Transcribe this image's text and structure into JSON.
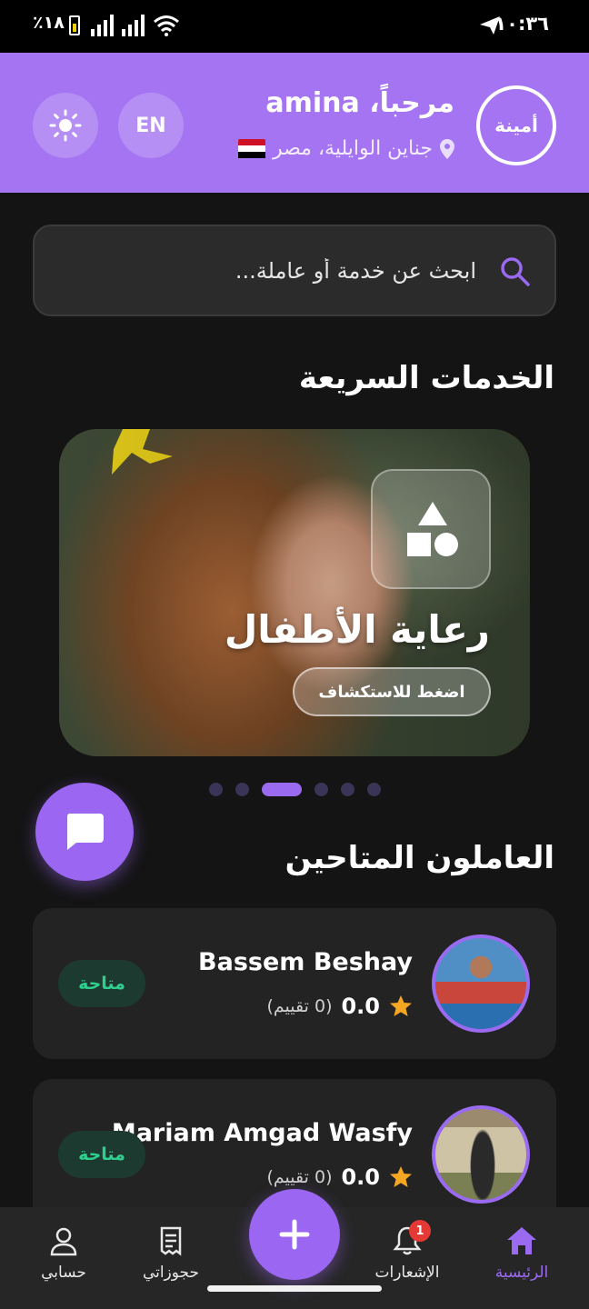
{
  "status_bar": {
    "time": "١٠:٣٦",
    "battery_pct": "٪١٨",
    "icons": [
      "telegram-send-icon",
      "battery-icon",
      "signal-icon",
      "signal-icon",
      "wifi-icon"
    ]
  },
  "header": {
    "logo_text": "أمينة",
    "greeting": "مرحباً، amina",
    "location": "جناين الوايلية، مصر",
    "flag": "egypt-flag-icon",
    "lang_button": "EN",
    "theme_icon": "sun-icon",
    "background_color": "#a474f2"
  },
  "search": {
    "placeholder": "ابحث عن خدمة أو عاملة...",
    "value": "",
    "icon": "search-icon"
  },
  "quick_services": {
    "title": "الخدمات السريعة",
    "carousel": {
      "title": "رعاية الأطفال",
      "cta": "اضغط للاستكشاف",
      "icon": "shapes-icon",
      "slide_count": 6,
      "active_index": 2
    }
  },
  "workers": {
    "title": "العاملون المتاحين",
    "items": [
      {
        "name": "Bassem Beshay",
        "rating": "0.0",
        "rating_count": "(0 تقييم)",
        "status": "متاحة"
      },
      {
        "name": "Mariam Amgad Wasfy",
        "rating": "0.0",
        "rating_count": "(0 تقييم)",
        "status": "متاحة"
      }
    ]
  },
  "chat_fab": {
    "icon": "chat-icon"
  },
  "bottom_nav": {
    "items": [
      {
        "label": "الرئيسية",
        "icon": "home-icon",
        "active": true
      },
      {
        "label": "الإشعارات",
        "icon": "bell-icon",
        "badge": "1"
      },
      {
        "label": "حجوزاتي",
        "icon": "receipt-icon"
      },
      {
        "label": "حسابي",
        "icon": "user-icon"
      }
    ],
    "add_icon": "plus-icon"
  },
  "colors": {
    "accent": "#9b66f2",
    "available": "#2fcf8e",
    "star": "#f5a623",
    "notification": "#e53935"
  }
}
